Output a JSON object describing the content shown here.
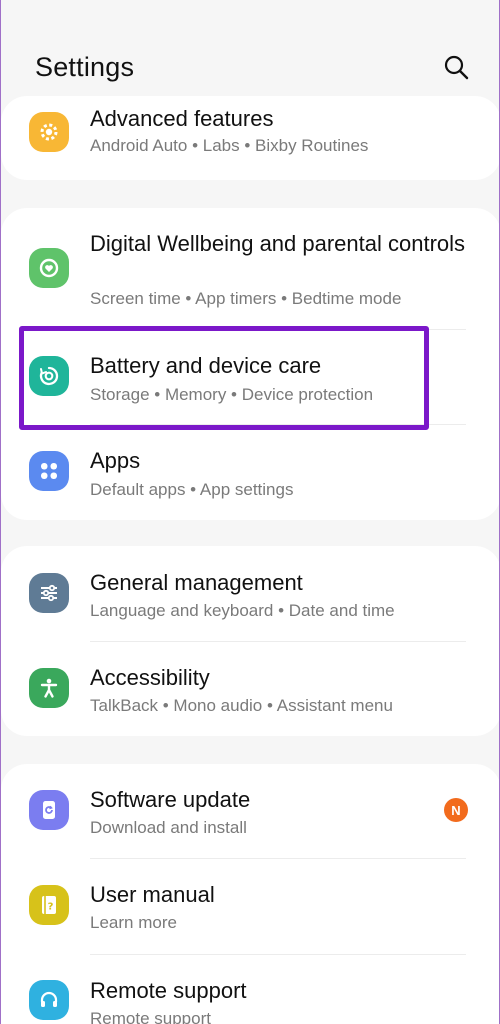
{
  "header": {
    "title": "Settings"
  },
  "groups": [
    {
      "items": [
        {
          "label": "Advanced features",
          "sub": "Android Auto  •  Labs  •  Bixby Routines",
          "icon": "gear-icon",
          "color": "#f8b735"
        }
      ]
    },
    {
      "items": [
        {
          "label": "Digital Wellbeing and parental controls",
          "sub": "Screen time  •  App timers  •  Bedtime mode",
          "icon": "wellbeing-icon",
          "color": "#5fc36a"
        },
        {
          "label": "Battery and device care",
          "sub": "Storage  •  Memory  •  Device protection",
          "icon": "device-care-icon",
          "color": "#1fb59a"
        },
        {
          "label": "Apps",
          "sub": "Default apps  •  App settings",
          "icon": "apps-grid-icon",
          "color": "#5b8af0"
        }
      ]
    },
    {
      "items": [
        {
          "label": "General management",
          "sub": "Language and keyboard  •  Date and time",
          "icon": "sliders-icon",
          "color": "#5f7b95"
        },
        {
          "label": "Accessibility",
          "sub": "TalkBack  •  Mono audio  •  Assistant menu",
          "icon": "accessibility-icon",
          "color": "#3aa85c"
        }
      ]
    },
    {
      "items": [
        {
          "label": "Software update",
          "sub": "Download and install",
          "icon": "software-update-icon",
          "color": "#7b7df0",
          "badge": "N"
        },
        {
          "label": "User manual",
          "sub": "Learn more",
          "icon": "manual-icon",
          "color": "#d7c21a"
        },
        {
          "label": "Remote support",
          "sub": "Remote support",
          "icon": "headset-icon",
          "color": "#2fb1e0"
        }
      ]
    }
  ],
  "colors": {
    "highlight": "#7b18c9",
    "badge": "#f26b1d"
  }
}
